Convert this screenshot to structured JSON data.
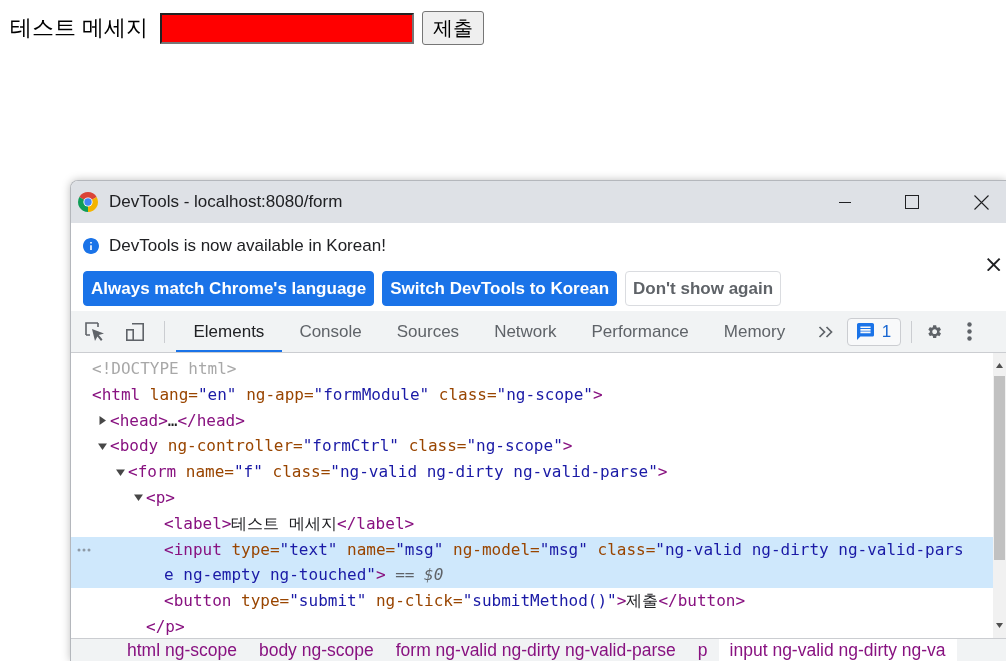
{
  "page": {
    "label": "테스트 메세지",
    "submit_button": "제출"
  },
  "devtools": {
    "title": "DevTools - localhost:8080/form",
    "infobar": {
      "message": "DevTools is now available in Korean!",
      "buttons": [
        {
          "label": "Always match Chrome's language",
          "kind": "primary"
        },
        {
          "label": "Switch DevTools to Korean",
          "kind": "primary"
        },
        {
          "label": "Don't show again",
          "kind": "secondary"
        }
      ]
    },
    "tabs": [
      {
        "label": "Elements",
        "selected": true
      },
      {
        "label": "Console",
        "selected": false
      },
      {
        "label": "Sources",
        "selected": false
      },
      {
        "label": "Network",
        "selected": false
      },
      {
        "label": "Performance",
        "selected": false
      },
      {
        "label": "Memory",
        "selected": false
      }
    ],
    "issues_count": "1",
    "dom_tree": [
      {
        "selected": false,
        "parts": [
          {
            "kind": "doctype",
            "text": "<!DOCTYPE html>"
          }
        ]
      },
      {
        "selected": false,
        "parts": [
          {
            "kind": "tag",
            "text": "<html"
          },
          {
            "kind": "attr",
            "text": " lang="
          },
          {
            "kind": "value",
            "text": "\"en\""
          },
          {
            "kind": "attr",
            "text": " ng-app="
          },
          {
            "kind": "value",
            "text": "\"formModule\""
          },
          {
            "kind": "attr",
            "text": " class="
          },
          {
            "kind": "value",
            "text": "\"ng-scope\""
          },
          {
            "kind": "tag",
            "text": ">"
          }
        ],
        "children": [
          {
            "selected": false,
            "expanded": false,
            "parts": [
              {
                "kind": "tag",
                "text": "<head>"
              },
              {
                "kind": "text",
                "text": "…"
              },
              {
                "kind": "tag",
                "text": "</head>"
              }
            ]
          },
          {
            "selected": false,
            "expanded": true,
            "parts": [
              {
                "kind": "tag",
                "text": "<body"
              },
              {
                "kind": "attr",
                "text": " ng-controller="
              },
              {
                "kind": "value",
                "text": "\"formCtrl\""
              },
              {
                "kind": "attr",
                "text": " class="
              },
              {
                "kind": "value",
                "text": "\"ng-scope\""
              },
              {
                "kind": "tag",
                "text": ">"
              }
            ],
            "children": [
              {
                "selected": false,
                "expanded": true,
                "parts": [
                  {
                    "kind": "tag",
                    "text": "<form"
                  },
                  {
                    "kind": "attr",
                    "text": " name="
                  },
                  {
                    "kind": "value",
                    "text": "\"f\""
                  },
                  {
                    "kind": "attr",
                    "text": " class="
                  },
                  {
                    "kind": "value",
                    "text": "\"ng-valid ng-dirty ng-valid-parse\""
                  },
                  {
                    "kind": "tag",
                    "text": ">"
                  }
                ],
                "children": [
                  {
                    "selected": false,
                    "expanded": true,
                    "parts": [
                      {
                        "kind": "tag",
                        "text": "<p>"
                      }
                    ],
                    "children": [
                      {
                        "selected": false,
                        "parts": [
                          {
                            "kind": "tag",
                            "text": "<label>"
                          },
                          {
                            "kind": "text",
                            "text": "테스트 메세지"
                          },
                          {
                            "kind": "tag",
                            "text": "</label>"
                          }
                        ]
                      },
                      {
                        "selected": true,
                        "parts": [
                          {
                            "kind": "tag",
                            "text": "<input"
                          },
                          {
                            "kind": "attr",
                            "text": " type="
                          },
                          {
                            "kind": "value",
                            "text": "\"text\""
                          },
                          {
                            "kind": "attr",
                            "text": " name="
                          },
                          {
                            "kind": "value",
                            "text": "\"msg\""
                          },
                          {
                            "kind": "attr",
                            "text": " ng-model="
                          },
                          {
                            "kind": "value",
                            "text": "\"msg\""
                          },
                          {
                            "kind": "attr",
                            "text": " class="
                          },
                          {
                            "kind": "value",
                            "text": "\"ng-valid ng-dirty ng-valid-parse ng-empty ng-touched\""
                          },
                          {
                            "kind": "tag",
                            "text": ">"
                          },
                          {
                            "kind": "ref",
                            "text": " =="
                          },
                          {
                            "kind": "ref-var",
                            "text": " $0"
                          }
                        ]
                      },
                      {
                        "selected": false,
                        "parts": [
                          {
                            "kind": "tag",
                            "text": "<button"
                          },
                          {
                            "kind": "attr",
                            "text": " type="
                          },
                          {
                            "kind": "value",
                            "text": "\"submit\""
                          },
                          {
                            "kind": "attr",
                            "text": " ng-click="
                          },
                          {
                            "kind": "value",
                            "text": "\"submitMethod()\""
                          },
                          {
                            "kind": "tag",
                            "text": ">"
                          },
                          {
                            "kind": "text",
                            "text": "제출"
                          },
                          {
                            "kind": "tag",
                            "text": "</button>"
                          }
                        ]
                      }
                    ],
                    "closing": [
                      {
                        "kind": "tag",
                        "text": "</p>"
                      }
                    ]
                  }
                ]
              }
            ]
          }
        ]
      }
    ],
    "breadcrumbs": [
      {
        "label": "html ng-scope",
        "selected": false
      },
      {
        "label": "body ng-scope",
        "selected": false
      },
      {
        "label": "form ng-valid ng-dirty ng-valid-parse",
        "selected": false
      },
      {
        "label": "p",
        "selected": false
      },
      {
        "label": "input ng-valid ng-dirty ng-va",
        "selected": true
      }
    ]
  }
}
